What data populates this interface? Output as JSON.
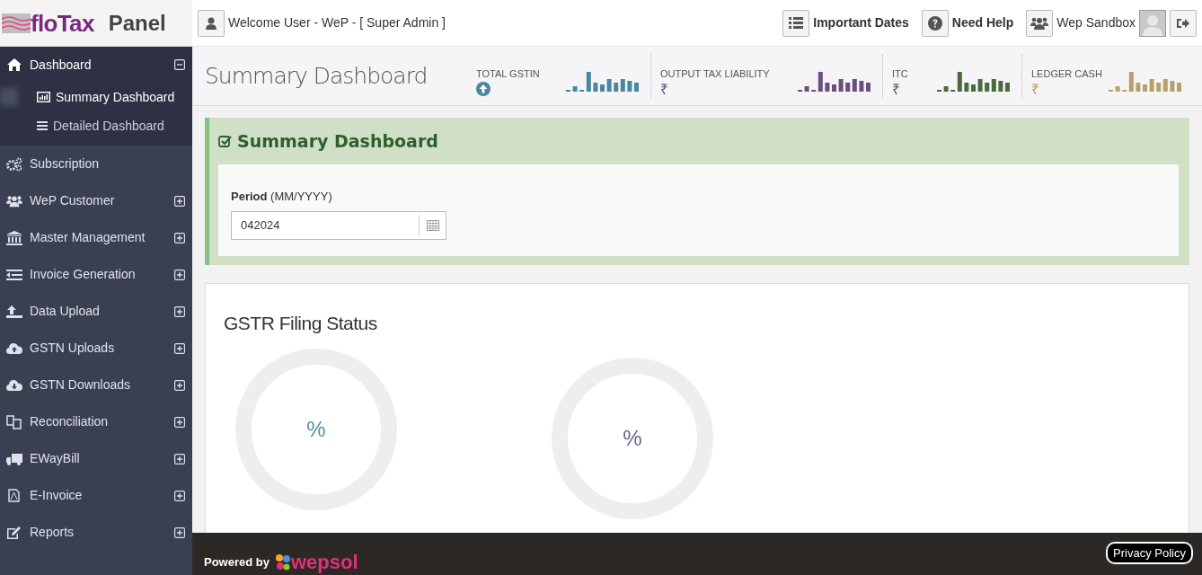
{
  "brand": {
    "logo": "floTax",
    "title": "Panel"
  },
  "header": {
    "welcome": "Welcome User - WeP - [ Super Admin ]",
    "actions": [
      {
        "kind": "dates",
        "label": "Important Dates"
      },
      {
        "kind": "help",
        "label": "Need Help"
      },
      {
        "kind": "users",
        "label": "Wep Sandbox"
      }
    ]
  },
  "sidebar": {
    "items": [
      {
        "label": "Dashboard",
        "selected": true,
        "expanded": true,
        "children": [
          {
            "label": "Summary Dashboard",
            "selected": true
          },
          {
            "label": "Detailed Dashboard",
            "selected": false
          }
        ]
      },
      {
        "label": "Subscription",
        "selected": false
      },
      {
        "label": "WeP Customer",
        "selected": false,
        "expanded": false
      },
      {
        "label": "Master Management",
        "selected": false,
        "expanded": false
      },
      {
        "label": "Invoice Generation",
        "selected": false,
        "expanded": false
      },
      {
        "label": "Data Upload",
        "selected": false,
        "expanded": false
      },
      {
        "label": "GSTN Uploads",
        "selected": false,
        "expanded": false
      },
      {
        "label": "GSTN Downloads",
        "selected": false,
        "expanded": false
      },
      {
        "label": "Reconciliation",
        "selected": false,
        "expanded": false
      },
      {
        "label": "EWayBill",
        "selected": false,
        "expanded": false
      },
      {
        "label": "E-Invoice",
        "selected": false,
        "expanded": false
      },
      {
        "label": "Reports",
        "selected": false,
        "expanded": false
      }
    ]
  },
  "page_title": "Summary Dashboard",
  "stats": [
    {
      "label": "TOTAL GSTIN",
      "kind": "arrow",
      "color": "#4a86a0"
    },
    {
      "label": "OUTPUT TAX LIABILITY",
      "kind": "rupee",
      "symbol": "₹",
      "color": "#6b4f7e"
    },
    {
      "label": "ITC",
      "kind": "rupee",
      "symbol": "₹",
      "color": "#4a6b3e"
    },
    {
      "label": "LEDGER CASH",
      "kind": "rupee",
      "symbol": "₹",
      "color": "#b9a06a"
    }
  ],
  "filter_panel": {
    "title": "Summary Dashboard",
    "field_label": "Period",
    "field_hint": "(MM/YYYY)",
    "value": "042024"
  },
  "status_card": {
    "title": "GSTR Filing Status",
    "donuts": [
      {
        "text": "%",
        "color": "#5a8ba3"
      },
      {
        "text": "%",
        "color": "#6e5d88"
      }
    ]
  },
  "footer": {
    "powered_by": "Powered by",
    "logo": "wepsol",
    "privacy": "Privacy Policy"
  }
}
